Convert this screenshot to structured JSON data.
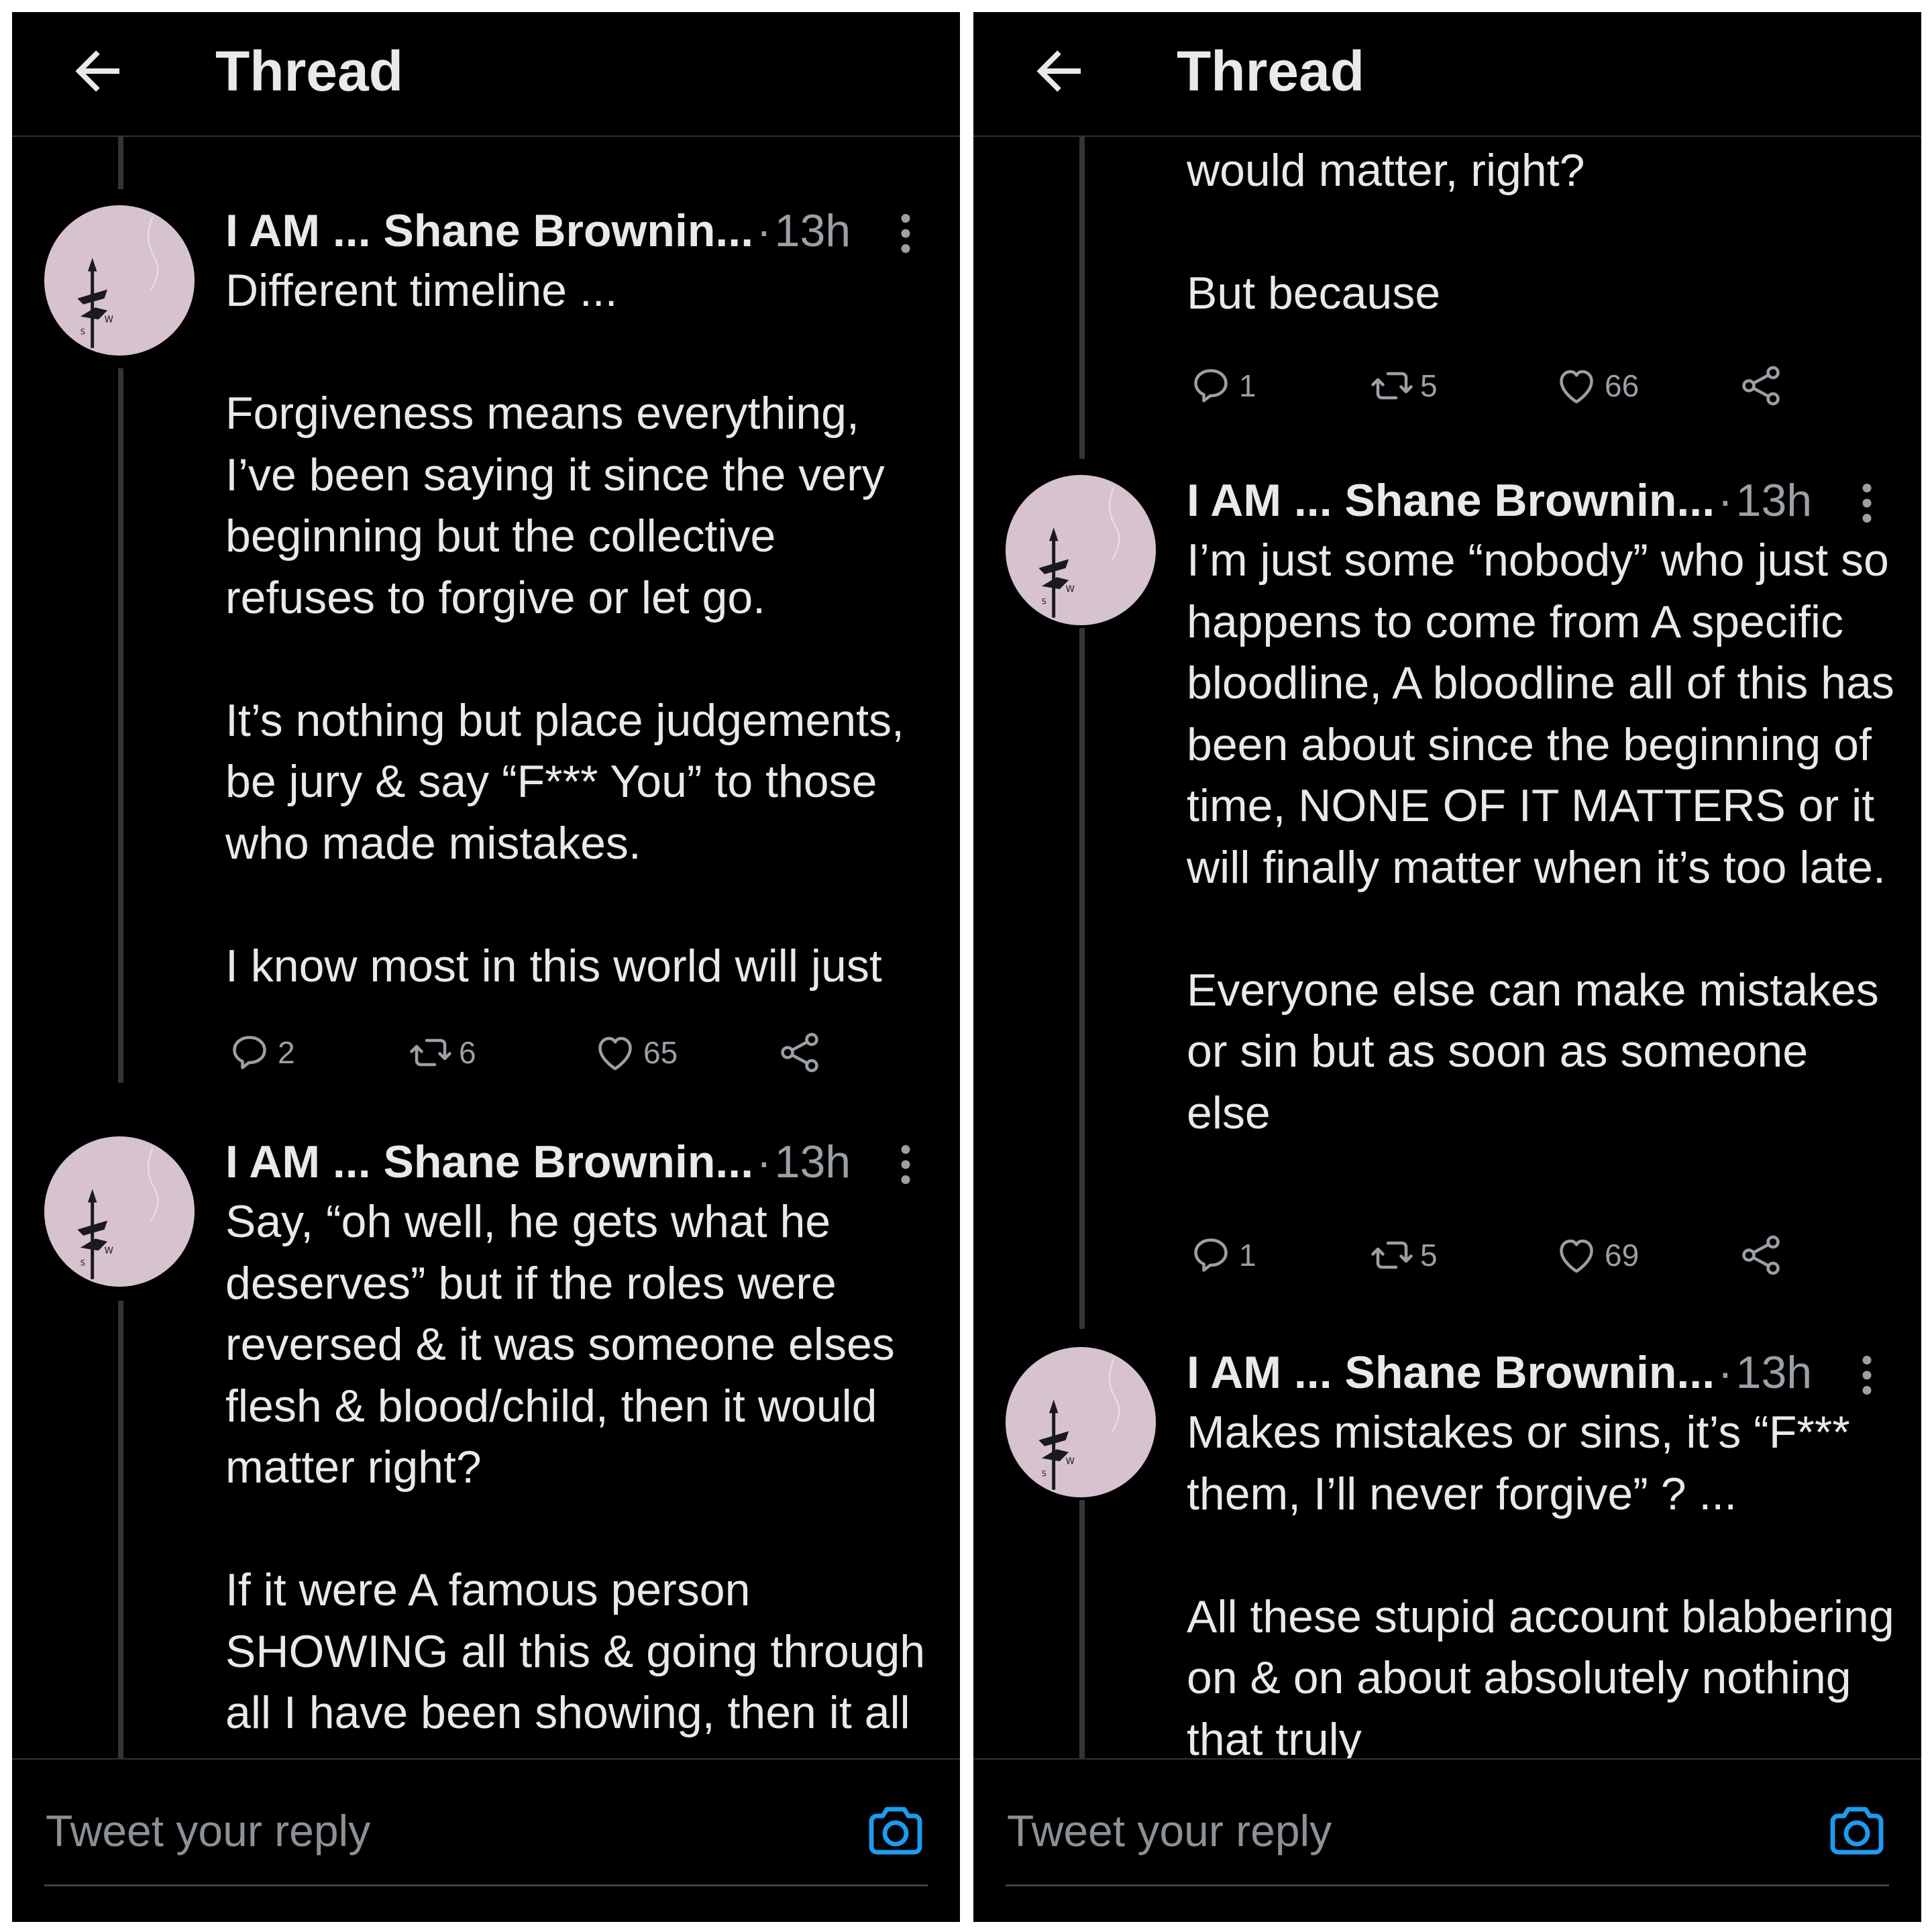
{
  "colors": {
    "background": "#000000",
    "text": "#e7e9ea",
    "muted": "#9aa0a6",
    "accent": "#1d9bf0",
    "avatar": "#d7c2d0"
  },
  "icons": {
    "back": "arrow-left-icon",
    "more": "more-vertical-icon",
    "reply": "comment-bubble-icon",
    "retweet": "retweet-icon",
    "like": "heart-icon",
    "share": "share-icon",
    "camera": "camera-icon"
  },
  "left": {
    "title": "Thread",
    "tweets": [
      {
        "author": "I AM ... Shane Brownin...",
        "sep": "·",
        "time": "13h",
        "paragraphs": [
          "Different timeline ...",
          "Forgiveness means everything, I’ve been saying it since the very beginning but the collective refuses to forgive or let go.",
          "It’s nothing but place judgements, be jury & say “F*** You” to those who made mistakes.",
          "I know most in this world will just"
        ],
        "replies": "2",
        "retweets": "6",
        "likes": "65"
      },
      {
        "author": "I AM ... Shane Brownin...",
        "sep": "·",
        "time": "13h",
        "paragraphs": [
          "Say, “oh well, he gets what he deserves” but if the roles were reversed & it was someone elses flesh & blood/child, then it would matter right?",
          "If it were A famous person SHOWING all this & going through all I have been showing, then it all"
        ]
      }
    ],
    "reply_placeholder": "Tweet your reply"
  },
  "right": {
    "title": "Thread",
    "partial": {
      "paragraphs": [
        "would matter, right?",
        "But because"
      ],
      "replies": "1",
      "retweets": "5",
      "likes": "66"
    },
    "tweets": [
      {
        "author": "I AM ... Shane Brownin...",
        "sep": "·",
        "time": "13h",
        "paragraphs": [
          "I’m just some “nobody” who just so happens to come from A specific bloodline, A bloodline all of this has been about since the beginning of time, NONE OF IT MATTERS or it will finally matter when it’s too late.",
          "Everyone else can make mistakes or sin but as soon as someone else"
        ],
        "replies": "1",
        "retweets": "5",
        "likes": "69"
      },
      {
        "author": "I AM ... Shane Brownin...",
        "sep": "·",
        "time": "13h",
        "paragraphs": [
          "Makes mistakes or sins, it’s “F*** them, I’ll never forgive” ? ...",
          "All these stupid account blabbering on & on about absolutely nothing that truly"
        ]
      }
    ],
    "reply_placeholder": "Tweet your reply"
  }
}
